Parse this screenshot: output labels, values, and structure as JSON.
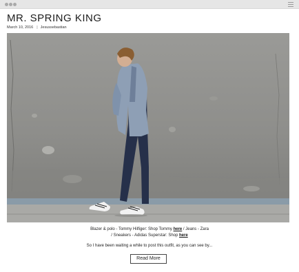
{
  "post": {
    "title": "MR. SPRING KING",
    "date": "March 10, 2016",
    "separator": "|",
    "author": "Jesussebastian"
  },
  "caption": {
    "line1_prefix": "Blazer & polo - Tommy Hilfiger: Shop Tommy ",
    "line1_link": "here",
    "line1_suffix": " / Jeans - Zara",
    "line2_prefix": "/ Sneakers - Adidas Superstar: Shop ",
    "line2_link": "here",
    "intro": "So I have been waiting a while to post this outfit, as you can see by..."
  },
  "read_more": "Read More",
  "icons": {
    "window_controls": "three-dots-icon",
    "menu": "hamburger-menu-icon"
  },
  "colors": {
    "chrome": "#e6e6e6",
    "title": "#1c1c1c",
    "wall": "#8f8f8d",
    "blazer": "#8e9fb5",
    "jeans": "#26304a"
  }
}
